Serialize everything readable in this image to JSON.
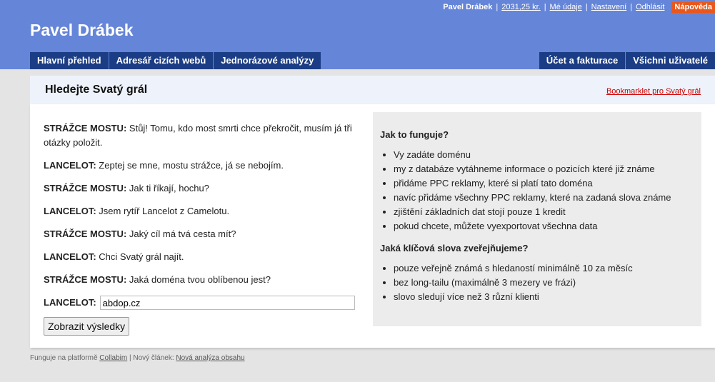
{
  "topbar": {
    "user": "Pavel Drábek",
    "credit": "2031,25 kr.",
    "links": [
      "Mé údaje",
      "Nastavení",
      "Odhlásit"
    ],
    "help": "Nápověda"
  },
  "brand": "Pavel Drábek",
  "nav": {
    "left": [
      "Hlavní přehled",
      "Adresář cizích webů",
      "Jednorázové analýzy"
    ],
    "right": [
      "Účet a fakturace",
      "Všichni uživatelé"
    ]
  },
  "page": {
    "title": "Hledejte Svatý grál",
    "bookmarklet": "Bookmarklet pro Svatý grál"
  },
  "dialog": [
    {
      "speaker": "STRÁŽCE MOSTU:",
      "text": "Stůj! Tomu, kdo most smrti chce překročit, musím já tři otázky položit."
    },
    {
      "speaker": "LANCELOT:",
      "text": "Zeptej se mne, mostu strážce, já se nebojím."
    },
    {
      "speaker": "STRÁŽCE MOSTU:",
      "text": "Jak ti říkají, hochu?"
    },
    {
      "speaker": "LANCELOT:",
      "text": "Jsem rytíř Lancelot z Camelotu."
    },
    {
      "speaker": "STRÁŽCE MOSTU:",
      "text": "Jaký cíl má tvá cesta mít?"
    },
    {
      "speaker": "LANCELOT:",
      "text": "Chci Svatý grál najít."
    },
    {
      "speaker": "STRÁŽCE MOSTU:",
      "text": "Jaká doména tvou oblíbenou jest?"
    }
  ],
  "answer": {
    "speaker": "LANCELOT:",
    "value": "abdop.cz"
  },
  "submit_label": "Zobrazit výsledky",
  "info": {
    "how_title": "Jak to funguje?",
    "how_items": [
      "Vy zadáte doménu",
      "my z databáze vytáhneme informace o pozicích které již známe",
      "přidáme PPC reklamy, které si platí tato doména",
      "navíc přidáme všechny PPC reklamy, které na zadaná slova známe",
      "zjištění základních dat stojí pouze 1 kredit",
      "pokud chcete, můžete vyexportovat všechna data"
    ],
    "keywords_title": "Jaká klíčová slova zveřejňujeme?",
    "keywords_items": [
      "pouze veřejně známá s hledaností minimálně 10 za měsíc",
      "bez long-tailu (maximálně 3 mezery ve frázi)",
      "slovo sledují více než 3 různí klienti"
    ]
  },
  "footer": {
    "prefix": "Funguje na platformě",
    "platform": "Collabim",
    "middle": "| Nový článek:",
    "article": "Nová analýza obsahu"
  }
}
